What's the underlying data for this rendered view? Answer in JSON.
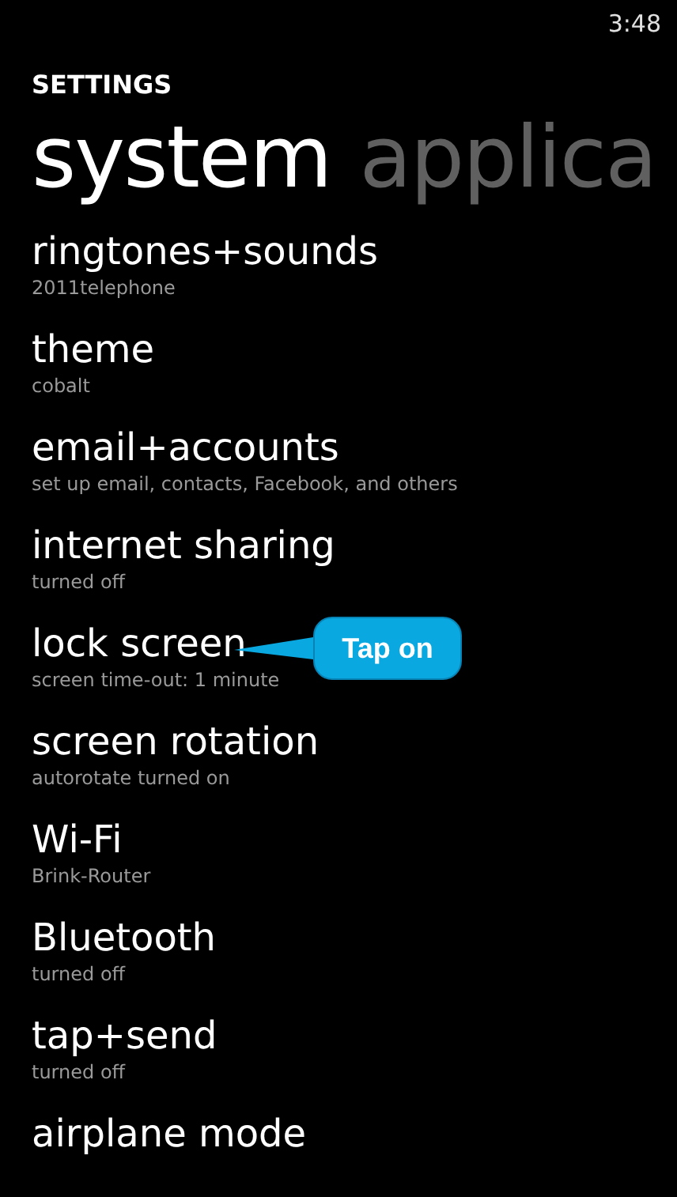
{
  "status_bar": {
    "time": "3:48"
  },
  "app_title": "SETTINGS",
  "pivots": [
    {
      "label": "system",
      "selected": true
    },
    {
      "label": "applica",
      "selected": false
    }
  ],
  "items": [
    {
      "title": "ringtones+sounds",
      "subtitle": "2011telephone"
    },
    {
      "title": "theme",
      "subtitle": "cobalt"
    },
    {
      "title": "email+accounts",
      "subtitle": "set up email, contacts, Facebook, and others"
    },
    {
      "title": "internet sharing",
      "subtitle": "turned off"
    },
    {
      "title": "lock screen",
      "subtitle": "screen time-out: 1 minute",
      "callout": "Tap on"
    },
    {
      "title": "screen rotation",
      "subtitle": "autorotate turned on"
    },
    {
      "title": "Wi-Fi",
      "subtitle": "Brink-Router"
    },
    {
      "title": "Bluetooth",
      "subtitle": "turned off"
    },
    {
      "title": "tap+send",
      "subtitle": "turned off"
    },
    {
      "title": "airplane mode"
    }
  ]
}
